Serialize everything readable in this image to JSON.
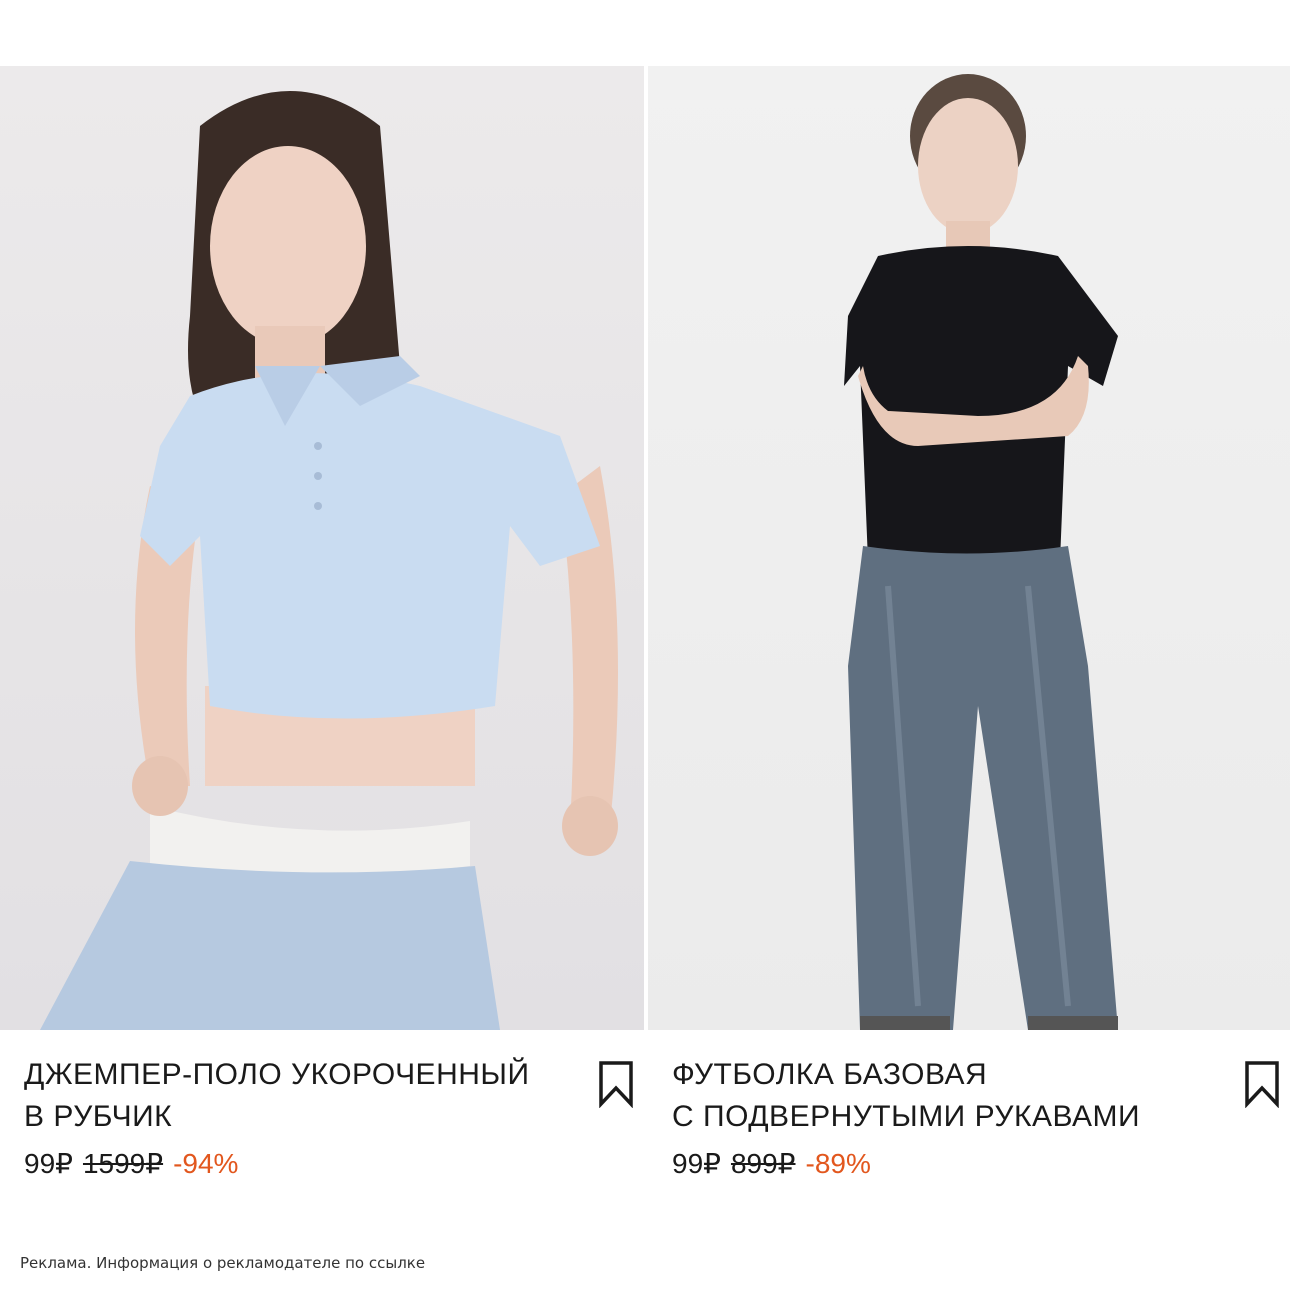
{
  "products": [
    {
      "title_line1": "ДЖЕМПЕР-ПОЛО УКОРОЧЕННЫЙ",
      "title_line2": "В РУБЧИК",
      "price_now": "99₽",
      "price_old": "1599₽",
      "discount": "-94%",
      "bookmark_icon": "bookmark-icon"
    },
    {
      "title_line1": "ФУТБОЛКА БАЗОВАЯ",
      "title_line2": "С ПОДВЕРНУТЫМИ РУКАВАМИ",
      "price_now": "99₽",
      "price_old": "899₽",
      "discount": "-89%",
      "bookmark_icon": "bookmark-icon"
    }
  ],
  "footer": {
    "ad_note": "Реклама. Информация о рекламодателе по ссылке"
  },
  "colors": {
    "discount": "#e2571e",
    "text": "#1a1a1a",
    "background": "#ffffff"
  }
}
